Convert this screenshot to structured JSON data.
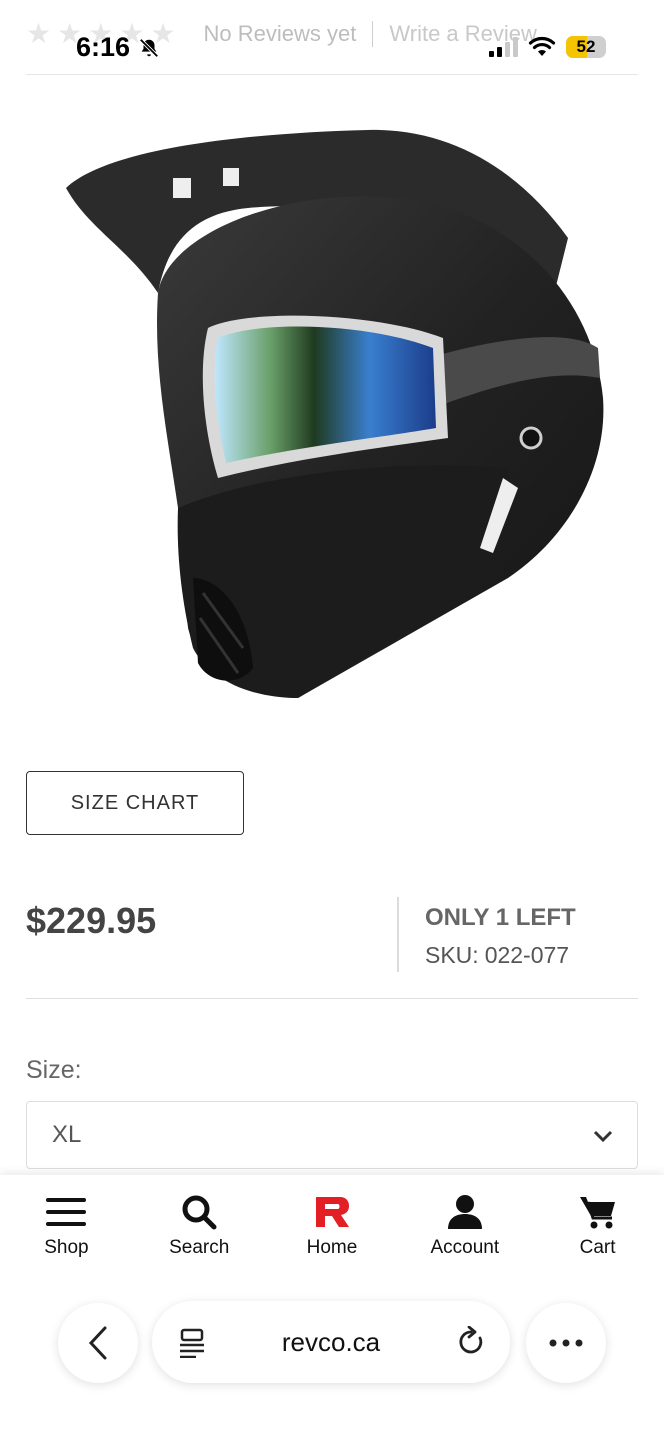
{
  "status_bar": {
    "time": "6:16",
    "battery": "52",
    "battery_level": 0.52
  },
  "reviews": {
    "no_reviews": "No Reviews yet",
    "write_review": "Write a Review",
    "stars": 5
  },
  "product": {
    "size_chart_label": "SIZE CHART",
    "price": "$229.95",
    "stock": "ONLY 1 LEFT",
    "sku_label": "SKU:",
    "sku_value": "022-077",
    "size_label": "Size:",
    "size_value": "XL"
  },
  "bottom_nav": {
    "items": [
      {
        "label": "Shop",
        "icon": "menu-icon"
      },
      {
        "label": "Search",
        "icon": "search-icon"
      },
      {
        "label": "Home",
        "icon": "revco-logo-icon"
      },
      {
        "label": "Account",
        "icon": "user-icon"
      },
      {
        "label": "Cart",
        "icon": "cart-icon"
      }
    ]
  },
  "browser": {
    "url": "revco.ca"
  },
  "colors": {
    "brand_red": "#e31e24",
    "battery_yellow": "#f5c400"
  }
}
